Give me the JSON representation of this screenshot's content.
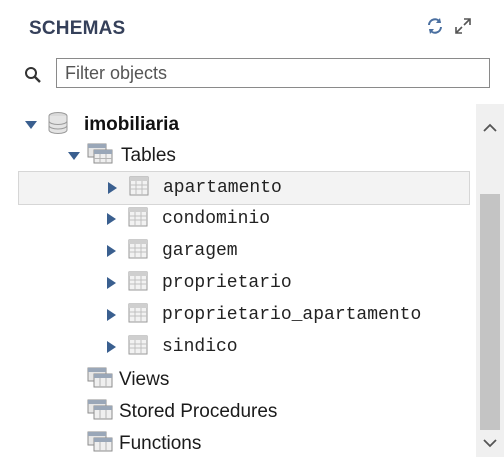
{
  "panel": {
    "title": "SCHEMAS",
    "refresh_icon": "refresh-icon",
    "expand_icon": "expand-icon"
  },
  "filter": {
    "placeholder": "Filter objects",
    "value": ""
  },
  "tree": {
    "schema": {
      "name": "imobiliaria",
      "icon": "database-icon",
      "expanded": true
    },
    "tables_group": {
      "label": "Tables",
      "icon": "table-group-icon",
      "expanded": true
    },
    "tables": [
      {
        "name": "apartamento",
        "selected": true
      },
      {
        "name": "condominio"
      },
      {
        "name": "garagem"
      },
      {
        "name": "proprietario"
      },
      {
        "name": "proprietario_apartamento"
      },
      {
        "name": "sindico"
      }
    ],
    "other_groups": [
      {
        "label": "Views",
        "icon": "views-icon"
      },
      {
        "label": "Stored Procedures",
        "icon": "stored-procedures-icon"
      },
      {
        "label": "Functions",
        "icon": "functions-icon"
      }
    ]
  },
  "colors": {
    "header_text": "#35405a",
    "selected_row_bg": "#f3f3f3",
    "scroll_track": "#f0f0f0",
    "scroll_thumb": "#c4c4c4"
  }
}
